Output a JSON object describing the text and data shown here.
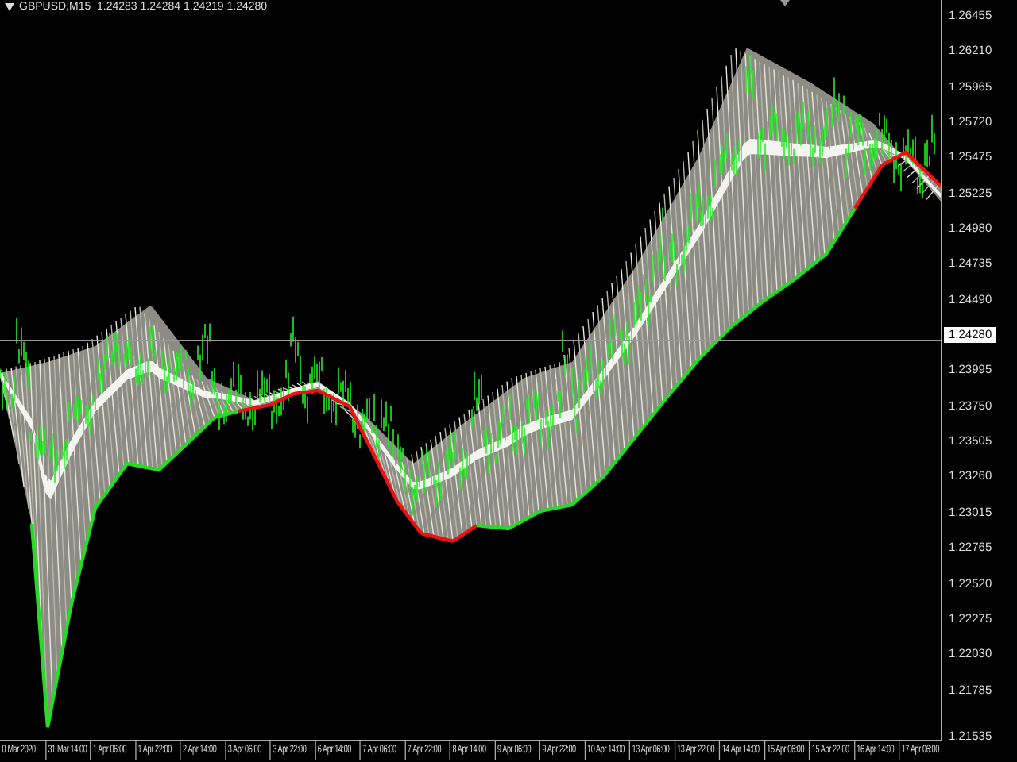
{
  "chart": {
    "header": "GBPUSD,M15  1.24283 1.24284 1.24219 1.24280",
    "price_labels": [
      "1.26455",
      "1.26210",
      "1.25965",
      "1.25720",
      "1.25475",
      "1.25225",
      "1.24980",
      "1.24735",
      "1.24490",
      "1.23995",
      "1.23750",
      "1.23505",
      "1.23260",
      "1.23015",
      "1.22765",
      "1.22520",
      "1.22275",
      "1.22030",
      "1.21785",
      "1.21535"
    ],
    "current_price": "1.24280",
    "time_labels": [
      "0 Mar 2020",
      "31 Mar 14:00",
      "1 Apr 06:00",
      "1 Apr 22:00",
      "2 Apr 14:00",
      "3 Apr 06:00",
      "3 Apr 22:00",
      "6 Apr 14:00",
      "7 Apr 06:00",
      "7 Apr 22:00",
      "8 Apr 14:00",
      "9 Apr 06:00",
      "9 Apr 22:00",
      "10 Apr 14:00",
      "13 Apr 06:00",
      "13 Apr 22:00",
      "14 Apr 14:00",
      "15 Apr 06:00",
      "15 Apr 22:00",
      "16 Apr 14:00",
      "17 Apr 06:00"
    ]
  }
}
